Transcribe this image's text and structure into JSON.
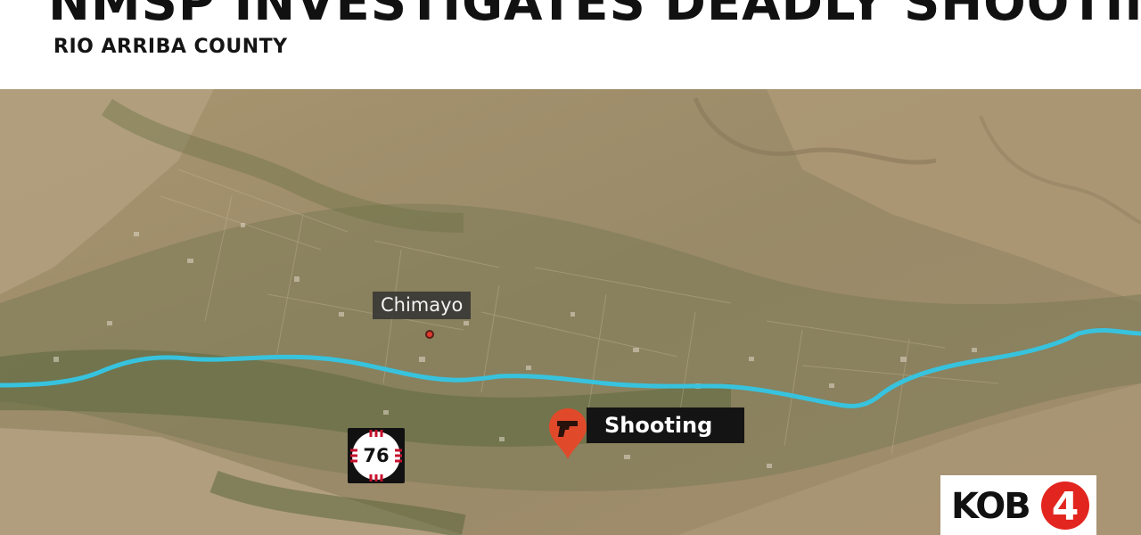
{
  "header": {
    "headline": "NMSP INVESTIGATES DEADLY SHOOTING",
    "subhead": "RIO ARRIBA COUNTY"
  },
  "map": {
    "view": "satellite",
    "place_label": "Chimayo",
    "route_number": "76",
    "incident_label": "Shooting",
    "incident_icon": "handgun-icon",
    "route_color": "#3fc6e0",
    "pin_color": "#e04a2a"
  },
  "branding": {
    "logo_text": "KOB",
    "logo_number": "4",
    "logo_color": "#e2251f"
  }
}
